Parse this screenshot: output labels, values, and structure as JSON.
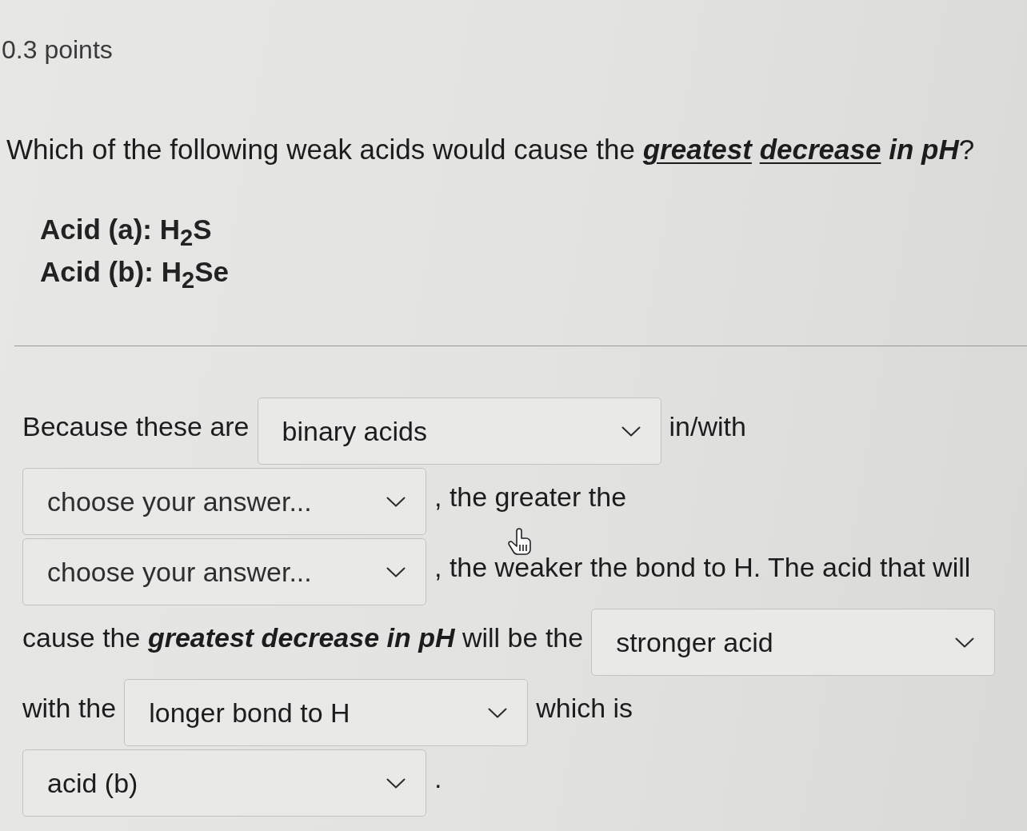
{
  "points": "0.3 points",
  "question": {
    "runs": [
      {
        "kind": "plain",
        "text": "Which of the following weak acids would cause the ",
        "underlined": false
      },
      {
        "kind": "emphasis",
        "text": "greatest ",
        "underlined": true
      },
      {
        "kind": "emphasis",
        "text": "decrease ",
        "underlined": true
      },
      {
        "kind": "emphasis",
        "text": "in pH",
        "underlined": false
      },
      {
        "kind": "plain",
        "text": "?",
        "underlined": false
      }
    ],
    "acids": [
      "Acid (a): H$_{2}$S",
      "Acid (b): H$_{2}$Se"
    ]
  },
  "answer": {
    "lines": [
      [
        {
          "kind": "text",
          "runs": [
            {
              "kind": "plain",
              "text": "Because these are"
            }
          ]
        },
        {
          "kind": "dropdown",
          "value": "binary acids"
        },
        {
          "kind": "text",
          "runs": [
            {
              "kind": "plain",
              "text": "in/with"
            }
          ]
        }
      ],
      [
        {
          "kind": "dropdown",
          "placeholder": "choose your answer..."
        },
        {
          "kind": "text",
          "runs": [
            {
              "kind": "plain",
              "text": ", the greater the"
            }
          ]
        }
      ],
      [
        {
          "kind": "dropdown",
          "placeholder": "choose your answer..."
        },
        {
          "kind": "text",
          "runs": [
            {
              "kind": "plain",
              "text": ", the weaker the bond to H. The acid that will"
            }
          ]
        }
      ],
      [
        {
          "kind": "text",
          "runs": [
            {
              "kind": "plain",
              "text": "cause the "
            },
            {
              "kind": "emphasis",
              "text": "greatest decrease in pH"
            },
            {
              "kind": "plain",
              "text": " will be the"
            }
          ]
        },
        {
          "kind": "dropdown",
          "value": "stronger acid"
        }
      ],
      [
        {
          "kind": "text",
          "runs": [
            {
              "kind": "plain",
              "text": "with the"
            }
          ]
        },
        {
          "kind": "dropdown",
          "value": "longer bond to H"
        },
        {
          "kind": "text",
          "runs": [
            {
              "kind": "plain",
              "text": "which is"
            }
          ]
        }
      ],
      [
        {
          "kind": "dropdown",
          "value": "acid (b)"
        },
        {
          "kind": "text",
          "runs": [
            {
              "kind": "plain",
              "text": "."
            }
          ]
        }
      ]
    ]
  }
}
